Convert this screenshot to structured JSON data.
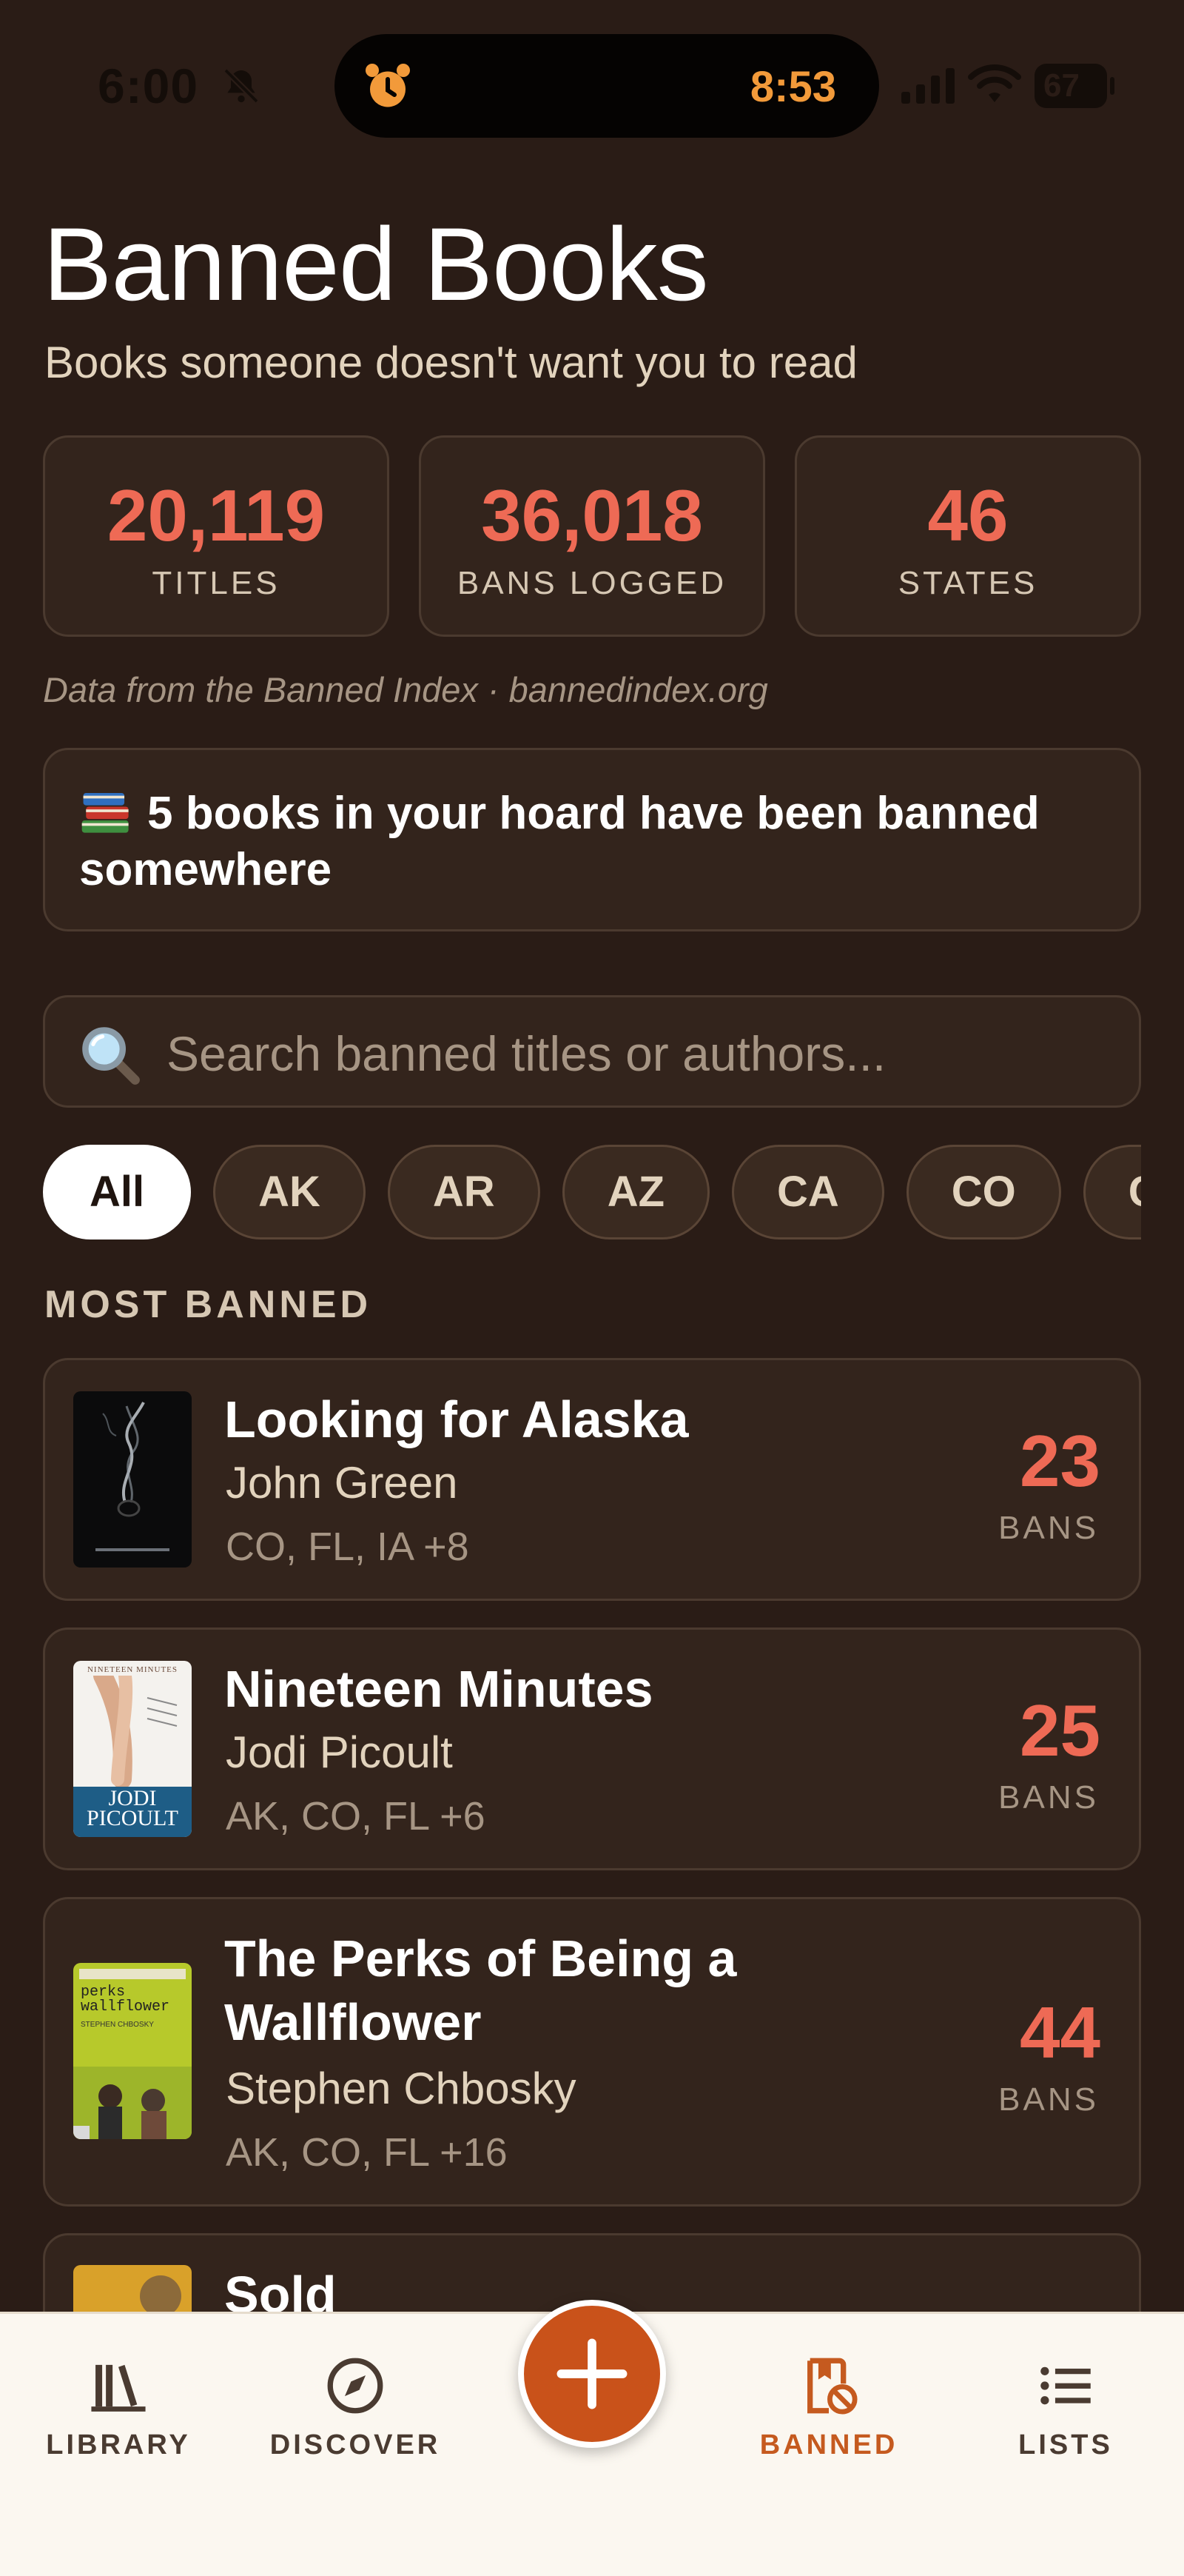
{
  "status_bar": {
    "time": "6:00",
    "island_time": "8:53",
    "battery": "67"
  },
  "header": {
    "title": "Banned Books",
    "subtitle": "Books someone doesn't want you to read"
  },
  "stats": [
    {
      "value": "20,119",
      "label": "TITLES"
    },
    {
      "value": "36,018",
      "label": "BANS LOGGED"
    },
    {
      "value": "46",
      "label": "STATES"
    }
  ],
  "data_source": "Data from the Banned Index · bannedindex.org",
  "hoard_banner": {
    "icon": "books-icon",
    "text": "5 books in your hoard have been banned somewhere"
  },
  "search": {
    "placeholder": "Search banned titles or authors..."
  },
  "filters": [
    "All",
    "AK",
    "AR",
    "AZ",
    "CA",
    "CO",
    "CT"
  ],
  "section_heading": "MOST BANNED",
  "books": [
    {
      "title": "Looking for Alaska",
      "author": "John Green",
      "states": "CO, FL, IA +8",
      "bans": "23",
      "bans_label": "BANS"
    },
    {
      "title": "Nineteen Minutes",
      "author": "Jodi Picoult",
      "states": "AK, CO, FL +6",
      "bans": "25",
      "bans_label": "BANS"
    },
    {
      "title_line1": "The Perks of Being a",
      "title_line2": "Wallflower",
      "author": "Stephen Chbosky",
      "states": "AK, CO, FL +16",
      "bans": "44",
      "bans_label": "BANS"
    },
    {
      "title": "Sold"
    }
  ],
  "covers": {
    "nineteen_minutes": {
      "top_text": "NINETEEN MINUTES",
      "author_first": "JODI",
      "author_last": "PICOULT"
    },
    "perks": {
      "title_text": "perks wallflower",
      "author_text": "STEPHEN CHBOSKY"
    }
  },
  "tab_bar": {
    "tabs": [
      {
        "label": "LIBRARY",
        "icon": "library-icon"
      },
      {
        "label": "DISCOVER",
        "icon": "compass-icon"
      },
      {
        "label": "BANNED",
        "icon": "banned-book-icon"
      },
      {
        "label": "LISTS",
        "icon": "list-icon"
      }
    ],
    "add_icon": "plus-icon",
    "active_color": "#c55a1f"
  },
  "colors": {
    "background": "#2a1c16",
    "accent": "#ee6a55",
    "card": "#33241c"
  }
}
